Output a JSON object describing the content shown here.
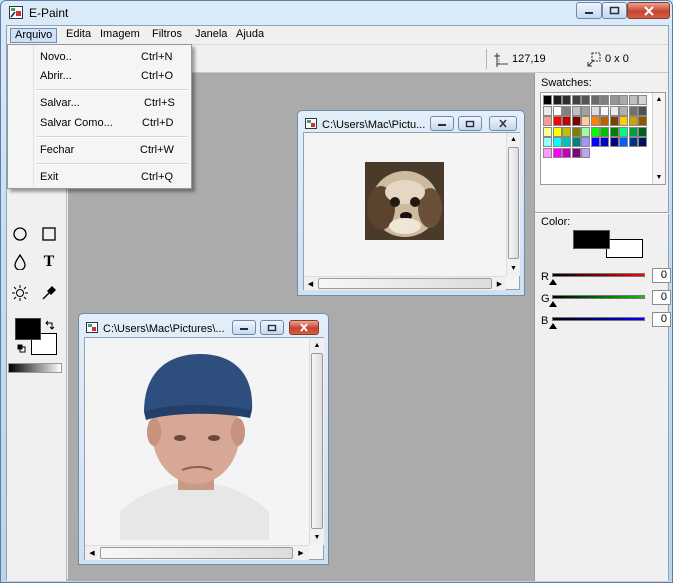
{
  "window": {
    "title": "E-Paint",
    "icon": "paint-app-icon",
    "caption_buttons": [
      "minimize-icon",
      "maximize-icon",
      "close-icon"
    ]
  },
  "menubar": {
    "items": [
      "Arquivo",
      "Edita",
      "Imagem",
      "Filtros",
      "Janela",
      "Ajuda"
    ],
    "open_menu": "Arquivo"
  },
  "file_menu": {
    "items": [
      {
        "label": "Novo..",
        "shortcut": "Ctrl+N"
      },
      {
        "label": "Abrir...",
        "shortcut": "Ctrl+O"
      },
      {
        "label": "Salvar...",
        "shortcut": "Ctrl+S"
      },
      {
        "label": "Salvar Como...",
        "shortcut": "Ctrl+D"
      },
      {
        "label": "Fechar",
        "shortcut": "Ctrl+W"
      },
      {
        "label": "Exit",
        "shortcut": "Ctrl+Q"
      }
    ]
  },
  "status": {
    "position": "127,19",
    "position_icon": "crosshair-position-icon",
    "selection_size": "0 x 0",
    "selection_icon": "selection-size-icon"
  },
  "tools": {
    "items": [
      "ellipse-tool-icon",
      "rectangle-tool-icon",
      "drop-tool-icon",
      "text-tool-icon",
      "brightness-tool-icon",
      "eyedropper-tool-icon"
    ],
    "text_tool_glyph": "T",
    "foreground_color": "#000000",
    "background_color": "#ffffff"
  },
  "documents": [
    {
      "title": "C:\\Users\\Mac\\Pictu...",
      "image": "dog-photo",
      "active": false
    },
    {
      "title": "C:\\Users\\Mac\\Pictures\\...",
      "image": "man-in-blue-cap-photo",
      "active": true
    }
  ],
  "swatches": {
    "label": "Swatches:",
    "colors": [
      "#000000",
      "#1c1c1c",
      "#2e2e2e",
      "#404040",
      "#555555",
      "#6a6a6a",
      "#7f7f7f",
      "#959595",
      "#aaaaaa",
      "#bfbfbf",
      "#d4d4d4",
      "#e9e9e9",
      "#ffffff",
      "#808080",
      "#c0c0c0",
      "#a0a0a0",
      "#dddddd",
      "#f8f8f8",
      "#ebebeb",
      "#b0b0b0",
      "#707070",
      "#505050",
      "#ff9999",
      "#ff0000",
      "#c00000",
      "#800000",
      "#ffcc99",
      "#ff8000",
      "#c06000",
      "#804000",
      "#ffcc00",
      "#d2a000",
      "#8c5a00",
      "#ffff99",
      "#ffff00",
      "#c0c000",
      "#808000",
      "#99ff99",
      "#00ff00",
      "#00c000",
      "#008000",
      "#00ff80",
      "#00a040",
      "#006020",
      "#99ffff",
      "#00ffff",
      "#00c0c0",
      "#008080",
      "#9999ff",
      "#0000ff",
      "#0000c0",
      "#000080",
      "#0060ff",
      "#003090",
      "#001060",
      "#ff99ff",
      "#ff00ff",
      "#c000c0",
      "#800080",
      "#c0a0ff"
    ]
  },
  "color_panel": {
    "label": "Color:",
    "foreground": "#000000",
    "background": "#ffffff",
    "channels": [
      {
        "label": "R",
        "value": "0",
        "color": "#ff0000"
      },
      {
        "label": "G",
        "value": "0",
        "color": "#00cc00"
      },
      {
        "label": "B",
        "value": "0",
        "color": "#0000ff"
      }
    ]
  }
}
